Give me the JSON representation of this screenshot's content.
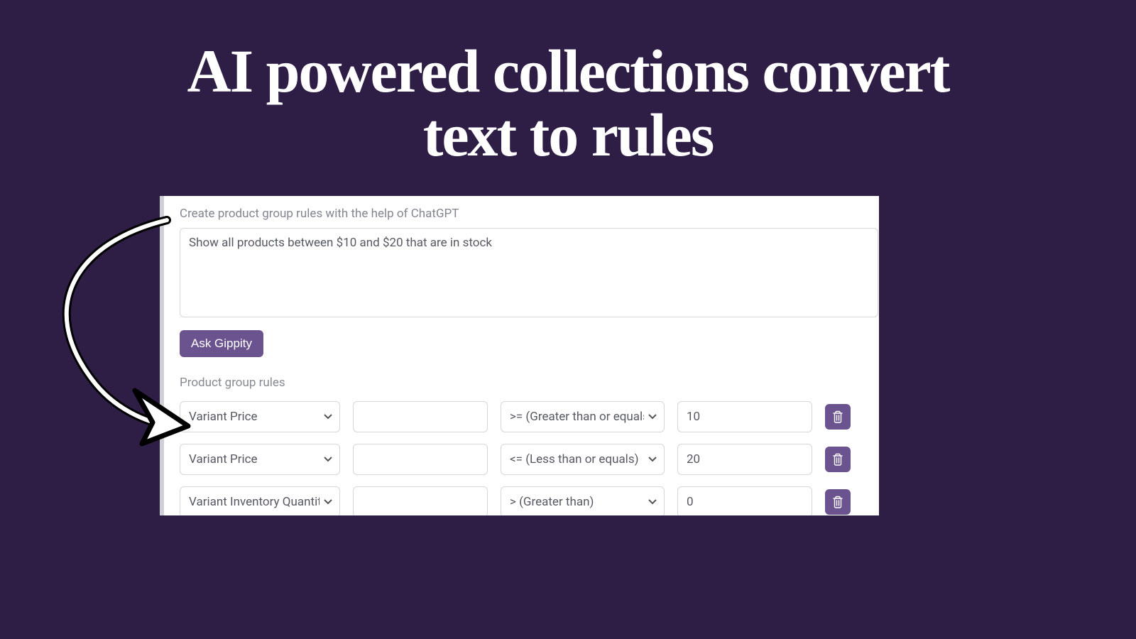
{
  "headline": "AI powered collections convert text to rules",
  "panel": {
    "prompt_label": "Create product group rules with the help of ChatGPT",
    "prompt_value": "Show all products between $10 and $20 that are in stock",
    "ask_label": "Ask Gippity",
    "rules_label": "Product group rules"
  },
  "rules": [
    {
      "attribute": "Variant Price",
      "mid": "",
      "operator": ">= (Greater than or equals)",
      "value": "10"
    },
    {
      "attribute": "Variant Price",
      "mid": "",
      "operator": "<= (Less than or equals)",
      "value": "20"
    },
    {
      "attribute": "Variant Inventory Quantity",
      "mid": "",
      "operator": "> (Greater than)",
      "value": "0"
    }
  ],
  "colors": {
    "bg": "#2e1e46",
    "accent": "#6a538e"
  }
}
